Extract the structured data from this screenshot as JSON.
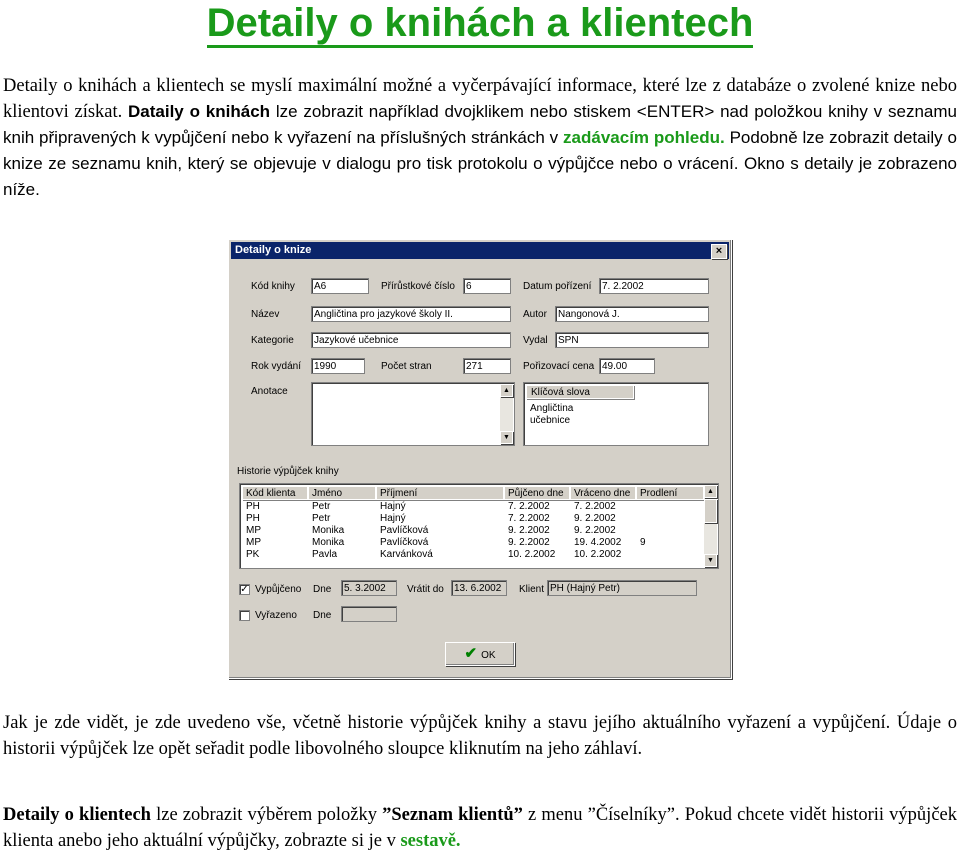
{
  "title": "Detaily o knihách a klientech",
  "intro": {
    "p1": "Detaily o knihách a klientech se myslí maximální možné a vyčerpávající informace, které lze z databáze o zvolené knize nebo klientovi získat. ",
    "b1": "Dataily o knihách",
    "p2": " lze zobrazit například dvojklikem nebo stiskem <ENTER> nad položkou knihy v seznamu knih připravených k vypůjčení nebo k vyřazení na příslušných stránkách v ",
    "g1": "zadávacím pohledu.",
    "p3": " Podobně lze zobrazit detaily o knize ze seznamu knih, který se objevuje v dialogu pro tisk protokolu o výpůjčce nebo o vrácení. Okno s detaily je zobrazeno níže."
  },
  "dialog": {
    "title": "Detaily o knize",
    "close": "×",
    "labels": {
      "kod": "Kód knihy",
      "prir": "Přírůstkové číslo",
      "datum": "Datum pořízení",
      "nazev": "Název",
      "autor": "Autor",
      "kategorie": "Kategorie",
      "vydal": "Vydal",
      "rok": "Rok vydání",
      "pocet": "Počet stran",
      "cena": "Pořizovací cena",
      "anotace": "Anotace"
    },
    "values": {
      "kod": "A6",
      "prir": "6",
      "datum": "7. 2.2002",
      "nazev": "Angličtina pro jazykové školy II.",
      "autor": "Nangonová J.",
      "kategorie": "Jazykové učebnice",
      "vydal": "SPN",
      "rok": "1990",
      "pocet": "271",
      "cena": "49.00"
    },
    "keywords": {
      "header": "Klíčová slova",
      "items": [
        "Angličtina",
        "učebnice"
      ]
    },
    "history": {
      "label": "Historie výpůjček knihy",
      "columns": [
        "Kód klienta",
        "Jméno",
        "Příjmení",
        "Půjčeno dne",
        "Vráceno dne",
        "Prodlení"
      ],
      "rows": [
        [
          "PH",
          "Petr",
          "Hajný",
          "7. 2.2002",
          "7. 2.2002",
          ""
        ],
        [
          "PH",
          "Petr",
          "Hajný",
          "7. 2.2002",
          "9. 2.2002",
          ""
        ],
        [
          "MP",
          "Monika",
          "Pavlíčková",
          "9. 2.2002",
          "9. 2.2002",
          ""
        ],
        [
          "MP",
          "Monika",
          "Pavlíčková",
          "9. 2.2002",
          "19. 4.2002",
          "9"
        ],
        [
          "PK",
          "Pavla",
          "Karvánková",
          "10. 2.2002",
          "10. 2.2002",
          ""
        ]
      ]
    },
    "vypujceno": {
      "label": "Vypůjčeno",
      "dne_label": "Dne",
      "dne": "5. 3.2002",
      "vratit_label": "Vrátit do",
      "vratit": "13. 6.2002",
      "klient_label": "Klient",
      "klient": "PH (Hajný Petr)",
      "check": "✓"
    },
    "vyrazeno": {
      "label": "Vyřazeno",
      "dne_label": "Dne",
      "dne": ""
    },
    "ok": "OK"
  },
  "para2": "Jak je zde vidět, je zde uvedeno vše, včetně historie výpůjček knihy a stavu jejího aktuálního vyřazení a vypůjčení. Údaje o historii výpůjček lze opět seřadit podle libovolného sloupce kliknutím na jeho záhlaví.",
  "para3": {
    "b1": "Detaily o klientech",
    "t1": " lze zobrazit výběrem položky ",
    "b2": "”Seznam klientů”",
    "t2": " z menu ”Číselníky”. Pokud chcete vidět historii výpůjček klienta anebo jeho aktuální výpůjčky, zobrazte si je v ",
    "g1": "sestavě."
  }
}
